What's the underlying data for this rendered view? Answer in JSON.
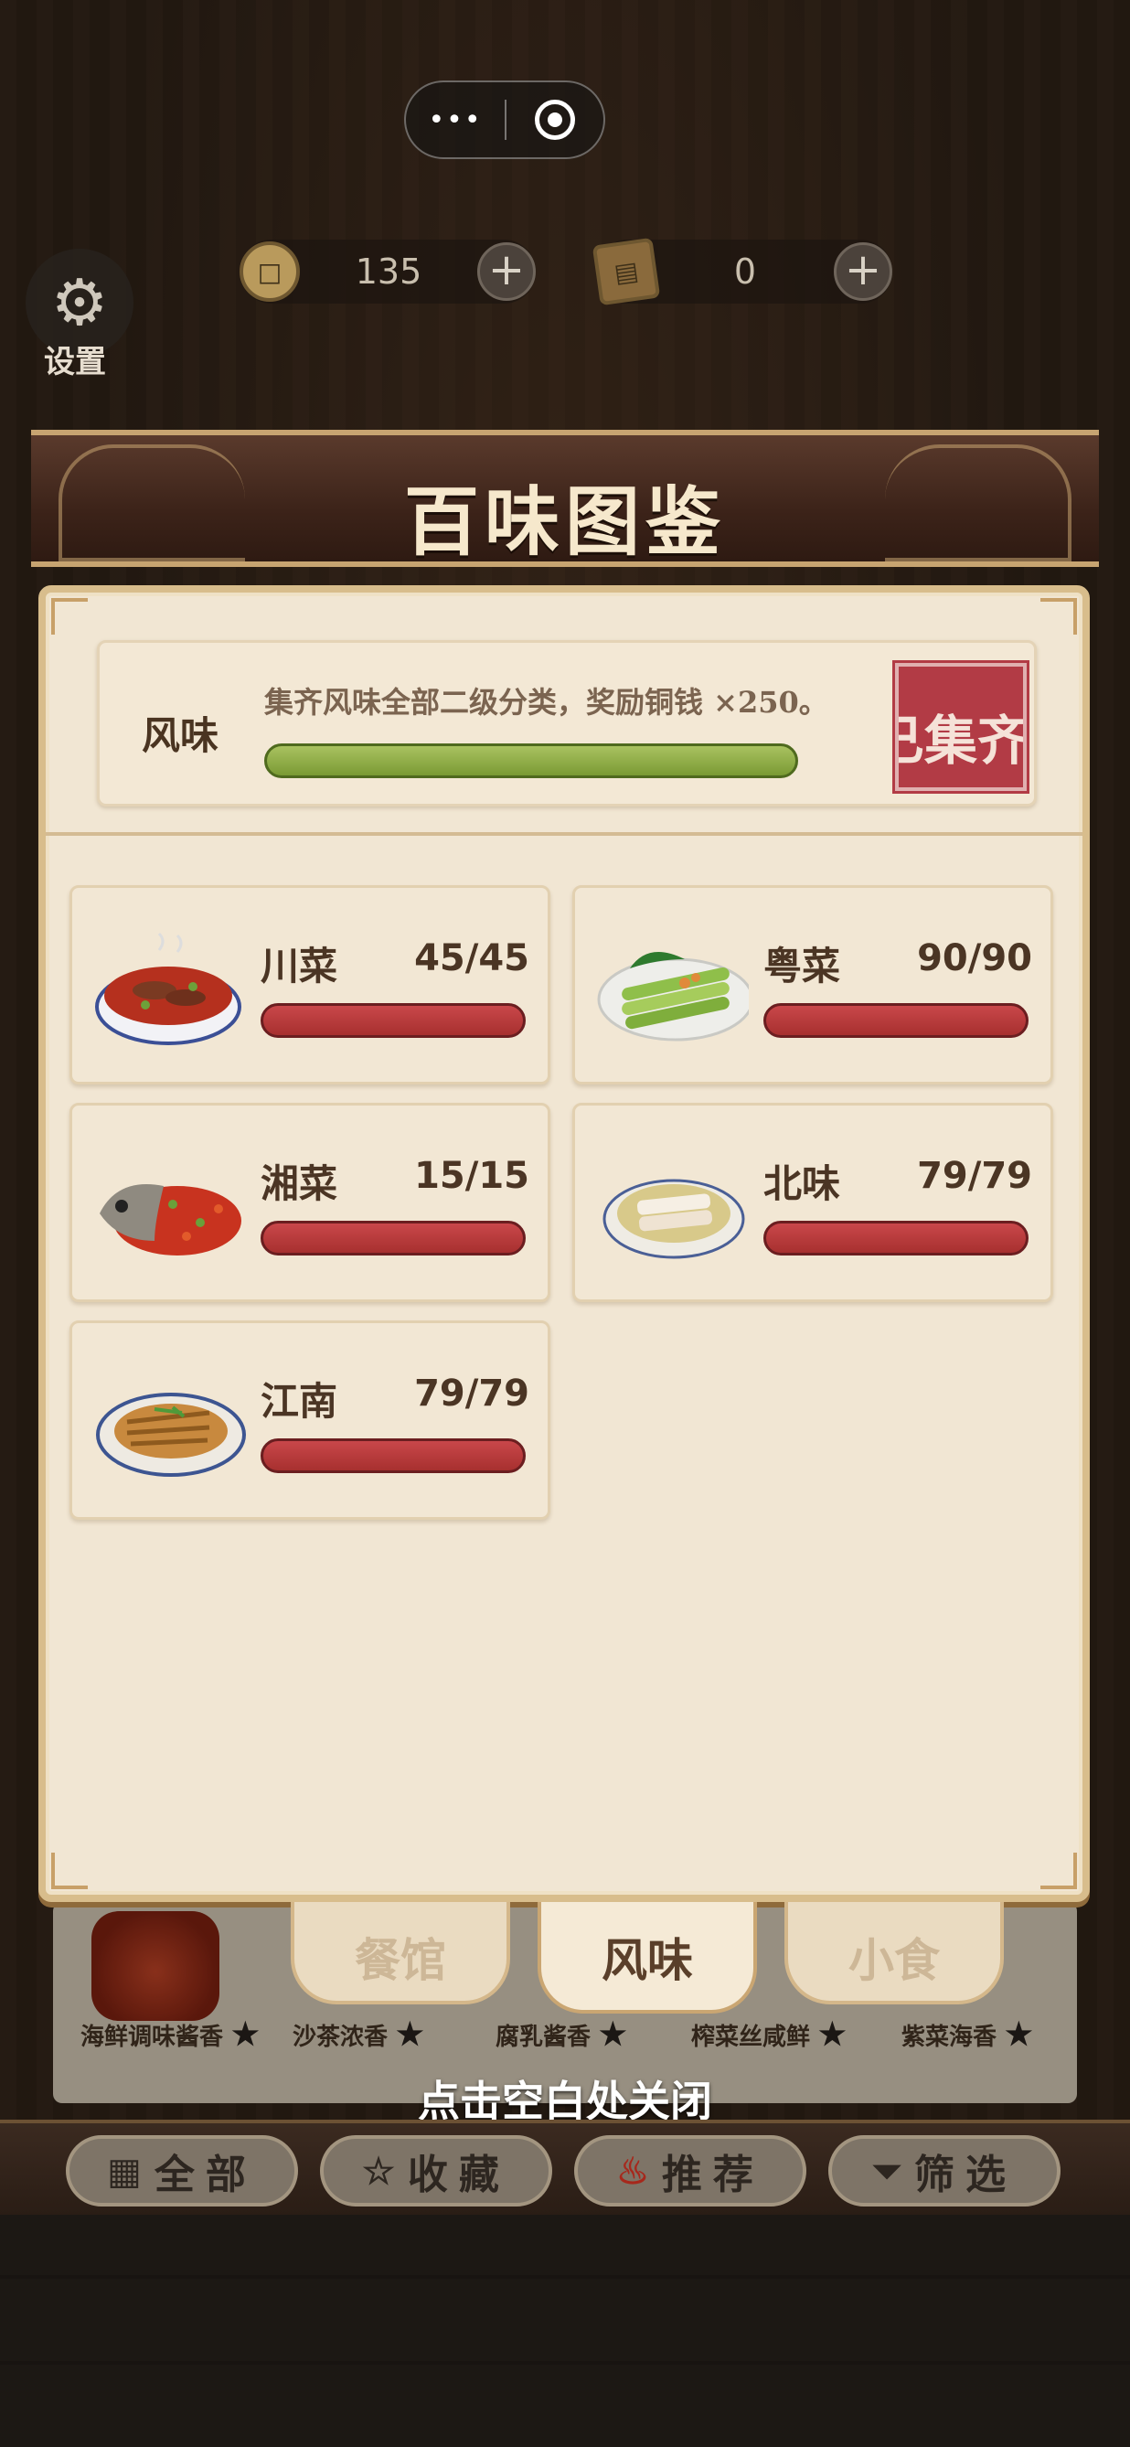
{
  "top": {
    "coins": "135",
    "books": "0",
    "settings_label": "设置",
    "capsule_more": "•••"
  },
  "header": {
    "title": "百味图鉴"
  },
  "summary": {
    "name": "风味",
    "description": "集齐风味全部二级分类，奖励铜钱 ×250。",
    "progress": 1.0,
    "stamp": "已集齐"
  },
  "categories": [
    {
      "name": "川菜",
      "count": "45/45",
      "progress": 1.0,
      "dish": "mala-beef-bowl"
    },
    {
      "name": "粤菜",
      "count": "90/90",
      "progress": 1.0,
      "dish": "choy-sum-plate"
    },
    {
      "name": "湘菜",
      "count": "15/15",
      "progress": 1.0,
      "dish": "chili-fish-head"
    },
    {
      "name": "北味",
      "count": "79/79",
      "progress": 1.0,
      "dish": "white-meat-plate"
    },
    {
      "name": "江南",
      "count": "79/79",
      "progress": 1.0,
      "dish": "braised-fish-plate"
    }
  ],
  "tabs": [
    "餐馆",
    "风味",
    "小食"
  ],
  "active_tab": "风味",
  "shelf": [
    "海鲜调味酱香",
    "沙茶浓香",
    "腐乳酱香",
    "榨菜丝咸鲜",
    "紫菜海香"
  ],
  "close_hint": "点击空白处关闭",
  "filters": [
    {
      "label": "全部",
      "icon": "grid-icon"
    },
    {
      "label": "收藏",
      "icon": "star-icon"
    },
    {
      "label": "推荐",
      "icon": "flame-icon"
    },
    {
      "label": "筛选",
      "icon": "funnel-icon"
    }
  ],
  "colors": {
    "accent_red": "#b23b45",
    "progress_green": "#7a9a34",
    "progress_red": "#a7302f"
  }
}
